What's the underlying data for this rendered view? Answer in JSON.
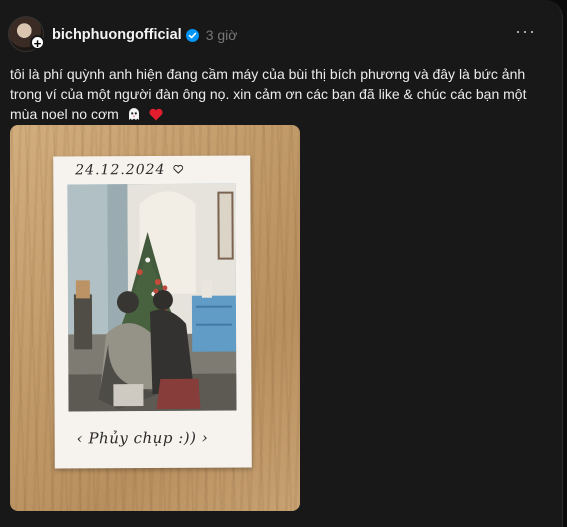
{
  "post": {
    "username": "bichphuongofficial",
    "timestamp": "3 giờ",
    "more_label": "···",
    "caption": "tôi là phí quỳnh anh hiện đang cầm máy của bùi thị bích phương và đây là bức ảnh trong ví của một người đàn ông nọ. xin cảm ơn các bạn đã like & chúc các bạn một mùa noel no cơm",
    "caption_emoji": [
      "ghost-face-icon",
      "red-heart-icon"
    ]
  },
  "photo": {
    "date_text": "24.12.2024",
    "caption_text": "Phủy chụp :))"
  },
  "colors": {
    "background": "#181818",
    "verified": "#0095f6",
    "heart": "#e11d2e"
  }
}
